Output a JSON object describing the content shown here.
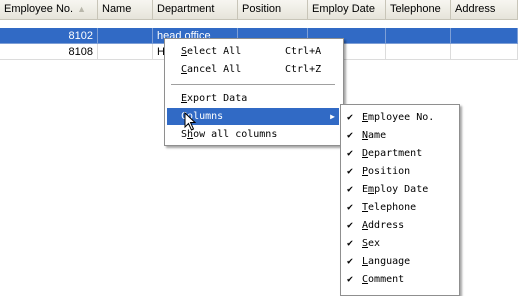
{
  "grid": {
    "columns": [
      "Employee No.",
      "Name",
      "Department",
      "Position",
      "Employ Date",
      "Telephone",
      "Address"
    ],
    "rows": [
      {
        "employee_no": "8102",
        "department": "head office"
      },
      {
        "employee_no": "8108",
        "department": "H"
      }
    ]
  },
  "context_menu": {
    "select_all": {
      "label": "Select All",
      "shortcut": "Ctrl+A"
    },
    "cancel_all": {
      "label": "Cancel All",
      "shortcut": "Ctrl+Z"
    },
    "export_data": {
      "label": "Export Data"
    },
    "columns": {
      "label": "Columns"
    },
    "show_all_columns": {
      "label": "Show all columns"
    }
  },
  "columns_submenu": {
    "check_glyph": "✔",
    "items": [
      "Employee No.",
      "Name",
      "Department",
      "Position",
      "Employ Date",
      "Telephone",
      "Address",
      "Sex",
      "Language",
      "Comment"
    ]
  },
  "colors": {
    "selection": "#316ac5",
    "header": "#ece9d8"
  }
}
